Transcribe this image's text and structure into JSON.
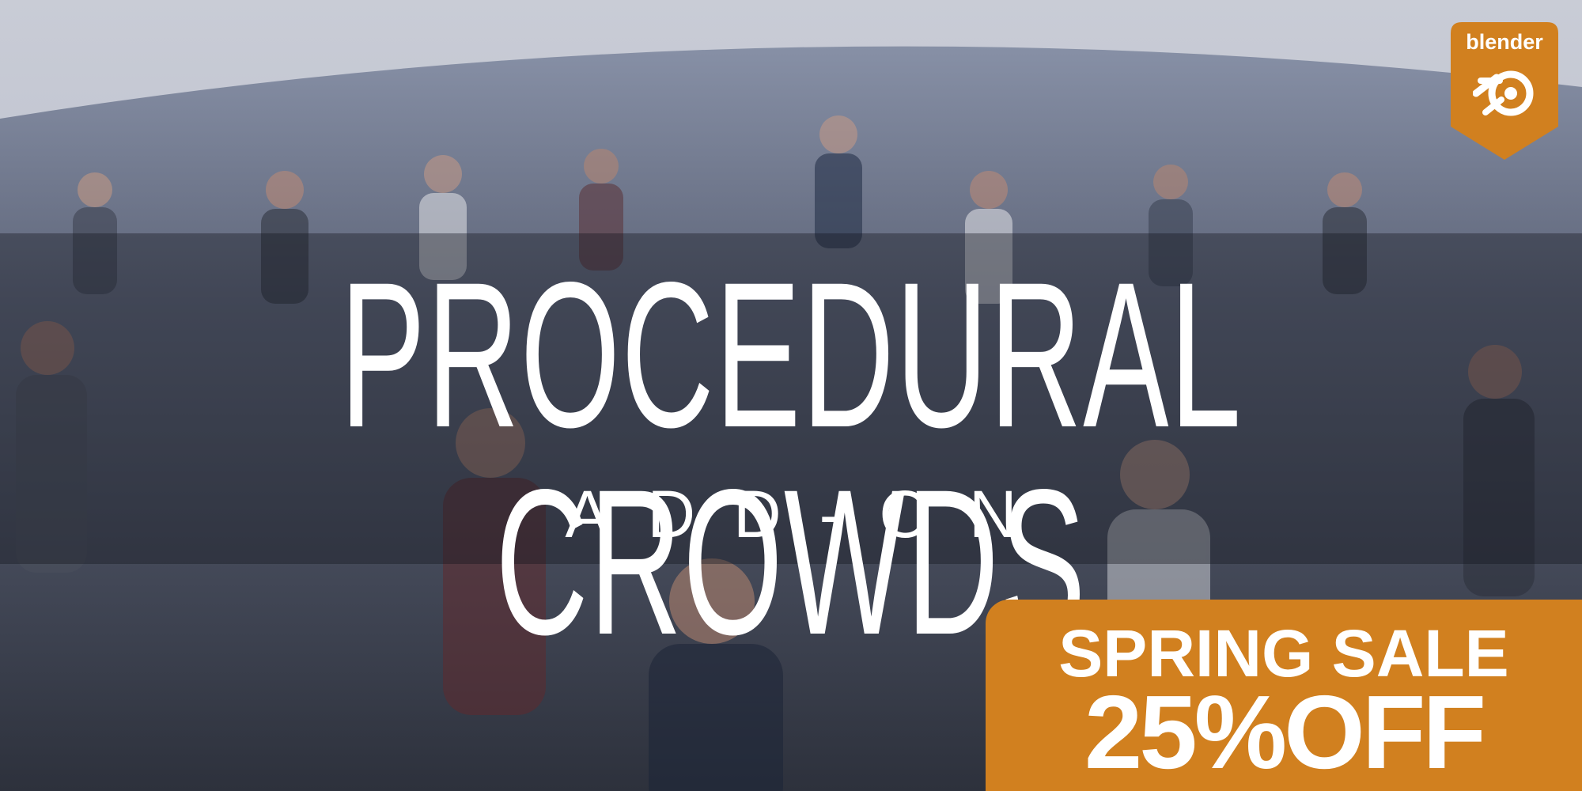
{
  "title": "PROCEDURAL CROWDS",
  "subtitle": "ADD-ON",
  "sale": {
    "line1": "SPRING SALE",
    "line2": "25%OFF"
  },
  "badge": {
    "text": "blender",
    "icon": "blender-logo-icon"
  },
  "colors": {
    "sale_orange": "#d1801f",
    "sky": "#c7cbd5",
    "ground": "#505663"
  }
}
